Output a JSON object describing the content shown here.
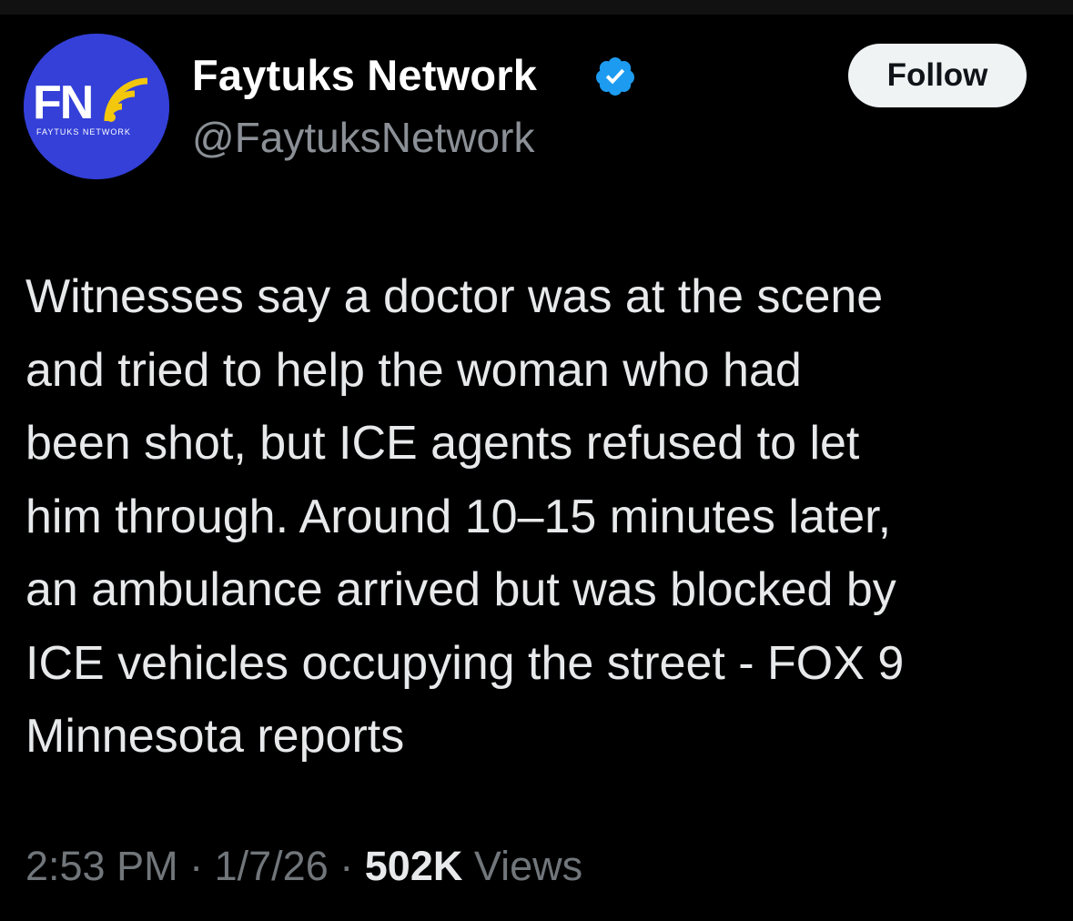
{
  "tweet": {
    "author": {
      "display_name": "Faytuks Network",
      "handle": "@FaytuksNetwork",
      "verified": true,
      "avatar": {
        "logo_letters": "FN",
        "logo_caption": "FAYTUKS NETWORK"
      }
    },
    "follow_label": "Follow",
    "text_lines": [
      "Witnesses say a doctor was at the scene",
      "and tried to help the woman who had",
      "been shot, but ICE agents refused to let",
      "him through. Around 10–15 minutes later,",
      "an ambulance arrived but was blocked by",
      "ICE vehicles occupying the street - FOX 9",
      "Minnesota reports"
    ],
    "meta": {
      "time": "2:53 PM",
      "separator": "·",
      "date": "1/7/26",
      "views_count": "502K",
      "views_label": "Views"
    }
  },
  "icons": {
    "verified": "verified-badge-icon"
  },
  "colors": {
    "background": "#000000",
    "text_primary": "#e7e9ea",
    "text_secondary": "#71767b",
    "verified_blue": "#1d9bf0",
    "avatar_blue": "#3440d8",
    "logo_yellow": "#f2c70c",
    "follow_button_bg": "#eff3f4"
  }
}
